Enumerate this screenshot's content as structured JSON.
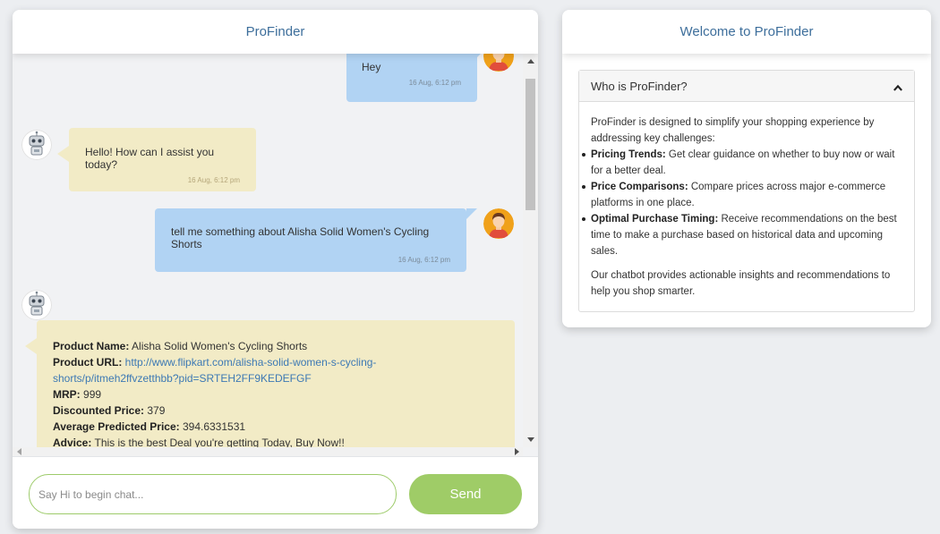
{
  "chat": {
    "title": "ProFinder",
    "messages": [
      {
        "sender": "user",
        "text": "Hey",
        "time": "16 Aug, 6:12 pm"
      },
      {
        "sender": "bot",
        "text": "Hello! How can I assist you today?",
        "time": "16 Aug, 6:12 pm"
      },
      {
        "sender": "user",
        "text": "tell me something about Alisha Solid Women's Cycling Shorts",
        "time": "16 Aug, 6:12 pm"
      },
      {
        "sender": "bot",
        "fields": [
          {
            "label": "Product Name:",
            "value": "Alisha Solid Women's Cycling Shorts"
          },
          {
            "label": "Product URL:",
            "value": "http://www.flipkart.com/alisha-solid-women-s-cycling-shorts/p/itmeh2ffvzetthbb?pid=SRTEH2FF9KEDEFGF"
          },
          {
            "label": "MRP:",
            "value": "999"
          },
          {
            "label": "Discounted Price:",
            "value": "379"
          },
          {
            "label": "Average Predicted Price:",
            "value": "394.6331531"
          },
          {
            "label": "Advice:",
            "value": "This is the best Deal you're getting Today, Buy Now!!"
          }
        ]
      }
    ],
    "input_placeholder": "Say Hi to begin chat...",
    "send_label": "Send"
  },
  "info": {
    "title": "Welcome to ProFinder",
    "accordion_title": "Who is ProFinder?",
    "intro": "ProFinder is designed to simplify your shopping experience by addressing key challenges:",
    "points": [
      {
        "label": "Pricing Trends:",
        "text": "Get clear guidance on whether to buy now or wait for a better deal."
      },
      {
        "label": "Price Comparisons:",
        "text": "Compare prices across major e-commerce platforms in one place."
      },
      {
        "label": "Optimal Purchase Timing:",
        "text": "Receive recommendations on the best time to make a purchase based on historical data and upcoming sales."
      }
    ],
    "outro": "Our chatbot provides actionable insights and recommendations to help you shop smarter."
  },
  "colors": {
    "title": "#3d6e9b",
    "user_bubble": "#b1d3f3",
    "bot_bubble": "#f2ebc6",
    "send_button": "#9fcc67",
    "input_border": "#9dcb6a",
    "link": "#3d79b4"
  },
  "icons": {
    "user_avatar": "user-avatar-icon",
    "bot_avatar": "robot-avatar-icon",
    "collapse": "chevron-up-icon"
  }
}
